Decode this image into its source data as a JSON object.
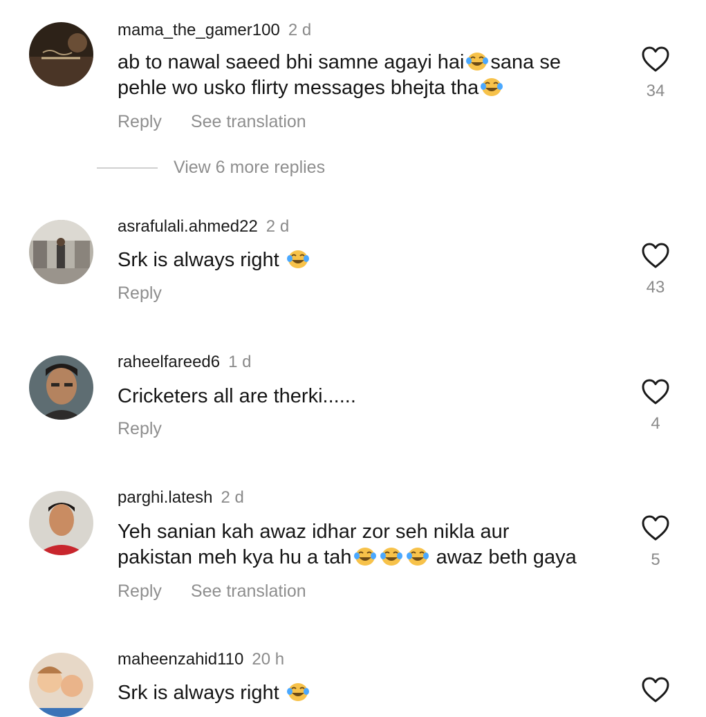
{
  "comments": [
    {
      "username": "mama_the_gamer100",
      "time": "2 d",
      "line1": "ab to nawal saeed bhi samne agayi hai",
      "line1b": "sana se",
      "line2": "pehle wo usko flirty messages bhejta tha",
      "reply": "Reply",
      "translate": "See translation",
      "likes": "34"
    },
    {
      "username": "asrafulali.ahmed22",
      "time": "2 d",
      "line1": "Srk is always right ",
      "reply": "Reply",
      "likes": "43"
    },
    {
      "username": "raheelfareed6",
      "time": "1 d",
      "line1": "Cricketers all are therki......",
      "reply": "Reply",
      "likes": "4"
    },
    {
      "username": "parghi.latesh",
      "time": "2 d",
      "line1": "Yeh sanian kah awaz idhar zor seh nikla aur",
      "line2": "pakistan meh kya hu a tah",
      "line2b": " awaz beth gaya",
      "reply": "Reply",
      "translate": "See translation",
      "likes": "5"
    },
    {
      "username": "maheenzahid110",
      "time": "20 h",
      "line1": "Srk is always right "
    }
  ],
  "view_replies": "View 6 more replies",
  "icons": {
    "like": "heart-outline-icon",
    "emoji": "face-with-tears-of-joy-emoji"
  },
  "colors": {
    "text": "#151515",
    "muted": "#8e8e8e",
    "emoji": "#f7c24a"
  }
}
